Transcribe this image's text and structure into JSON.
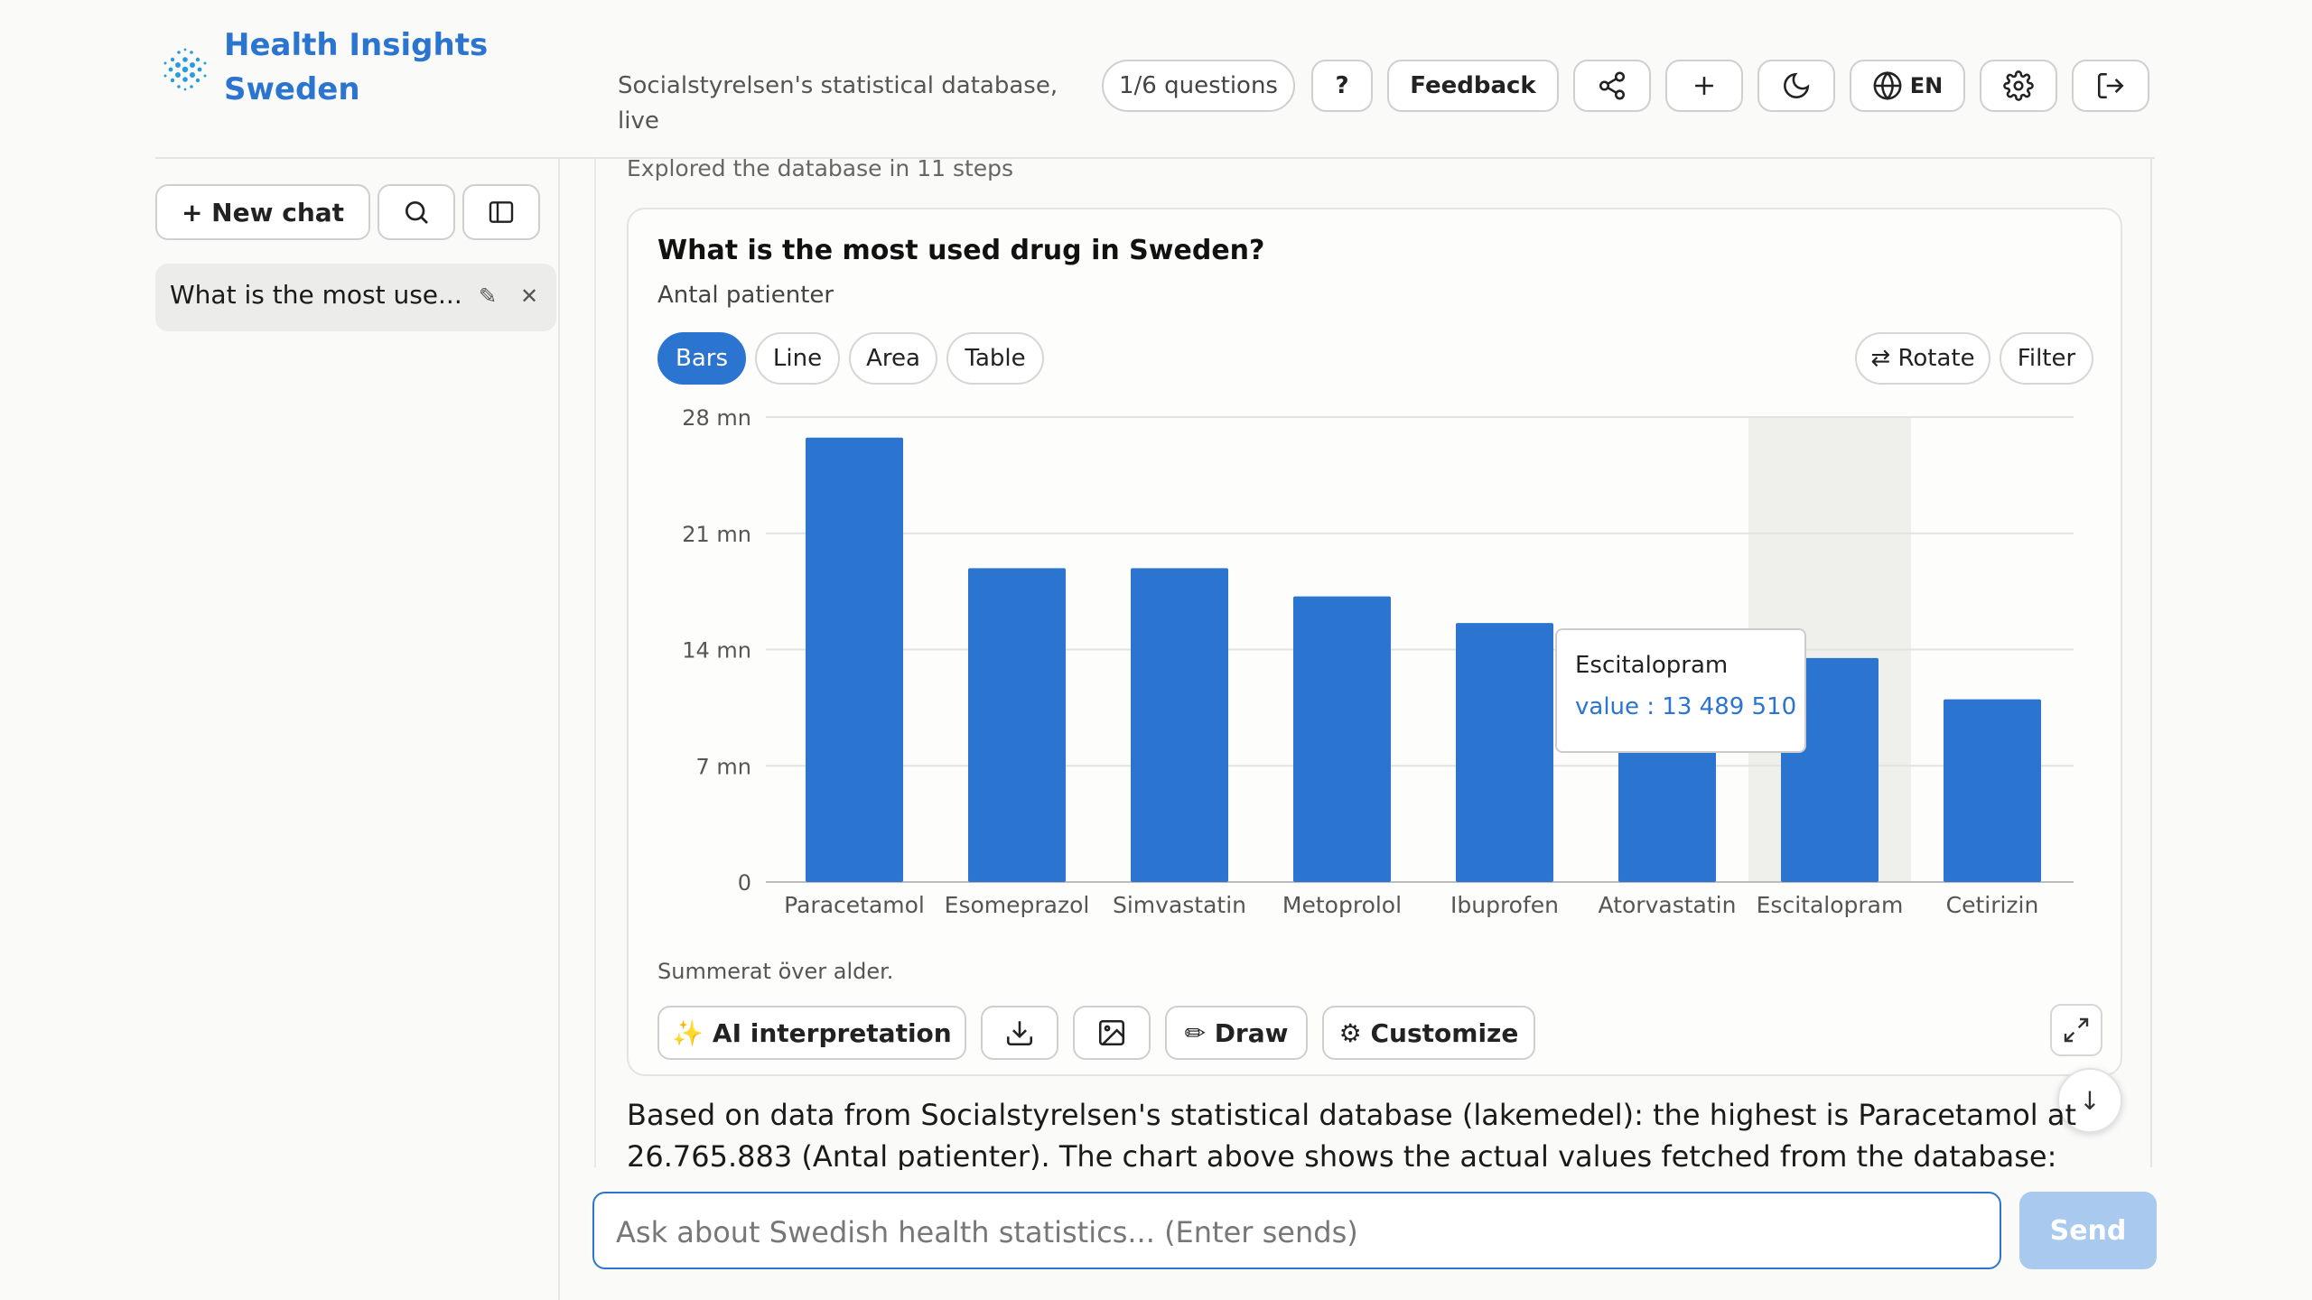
{
  "app": {
    "brand_line1": "Health Insights",
    "brand_line2": "Sweden",
    "subtitle": "Socialstyrelsen's statistical database, live",
    "accent_color": "#2b74cf"
  },
  "header": {
    "questions": "1/6 questions",
    "help": "?",
    "feedback": "Feedback",
    "lang": "EN",
    "icons": [
      "share-icon",
      "plus-icon",
      "moon-icon",
      "globe-icon",
      "gear-icon",
      "logout-icon"
    ]
  },
  "sidebar": {
    "new_chat": "+ New chat",
    "chats": [
      {
        "label": "What is the most use..."
      }
    ]
  },
  "main": {
    "explored": "Explored the database in 11 steps",
    "card": {
      "title": "What is the most used drug in Sweden?",
      "subtitle": "Antal patienter",
      "tabs": [
        "Bars",
        "Line",
        "Area",
        "Table"
      ],
      "active_tab": "Bars",
      "rotate": "⇄ Rotate",
      "filter": "Filter",
      "note": "Summerat över alder.",
      "actions": {
        "ai": "✨ AI interpretation",
        "draw": "✏ Draw",
        "customize": "⚙ Customize"
      },
      "tooltip": {
        "name": "Escitalopram",
        "value": "value : 13 489 510"
      }
    },
    "answer": "Based on data from Socialstyrelsen's statistical database (lakemedel): the highest is Paracetamol at 26.765.883 (Antal patienter). The chart above shows the actual values fetched from the database: every API"
  },
  "input": {
    "placeholder": "Ask about Swedish health statistics... (Enter sends)",
    "send": "Send"
  },
  "chart_data": {
    "type": "bar",
    "title": "What is the most used drug in Sweden?",
    "subtitle": "Antal patienter",
    "categories": [
      "Paracetamol",
      "Esomeprazol",
      "Simvastatin",
      "Metoprolol",
      "Ibuprofen",
      "Atorvastatin",
      "Escitalopram",
      "Cetirizin"
    ],
    "values": [
      26765883,
      18900000,
      18900000,
      17200000,
      15600000,
      14000000,
      13489510,
      11000000
    ],
    "ylim": [
      0,
      28000000
    ],
    "yticks": [
      0,
      7000000,
      14000000,
      21000000,
      28000000
    ],
    "ytick_labels": [
      "0",
      "7 mn",
      "14 mn",
      "21 mn",
      "28 mn"
    ],
    "highlighted_category": "Escitalopram",
    "bar_color": "#2b74cf",
    "grid": true
  }
}
